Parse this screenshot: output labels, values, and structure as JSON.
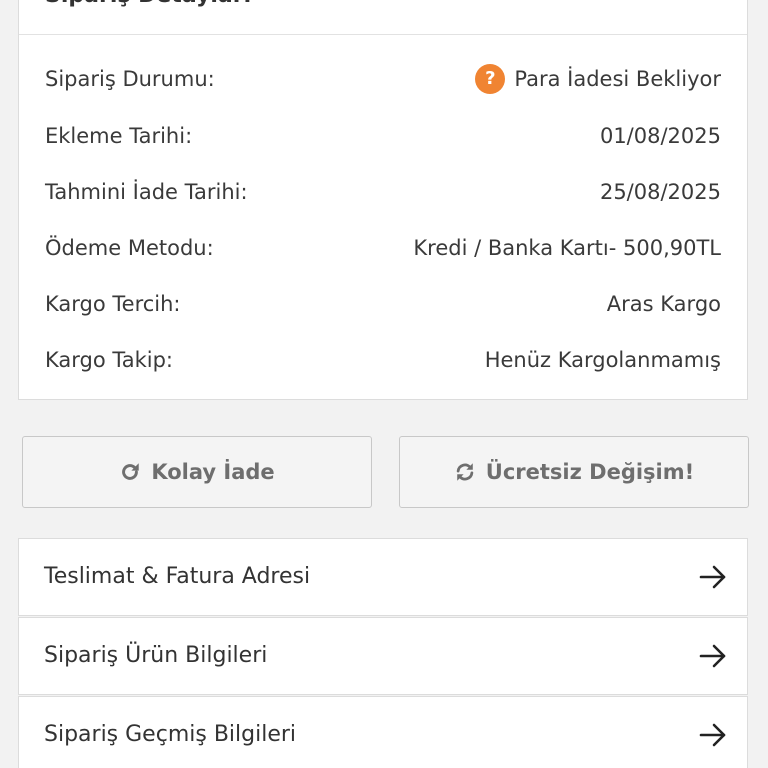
{
  "details": {
    "header_title": "Sipariş Detayları",
    "rows": [
      {
        "label": "Sipariş Durumu:",
        "value": "Para İadesi Bekliyor"
      },
      {
        "label": "Ekleme Tarihi:",
        "value": "01/08/2025"
      },
      {
        "label": "Tahmini İade Tarihi:",
        "value": "25/08/2025"
      },
      {
        "label": "Ödeme Metodu:",
        "value": "Kredi / Banka Kartı- 500,90TL"
      },
      {
        "label": "Kargo Tercih:",
        "value": "Aras Kargo"
      },
      {
        "label": "Kargo Takip:",
        "value": "Henüz Kargolanmamış"
      }
    ],
    "status_icon": "question-circle-icon",
    "status_icon_glyph": "?",
    "status_color": "#f08432"
  },
  "actions": {
    "easy_return_label": "Kolay İade",
    "easy_return_icon": "redo-icon",
    "free_exchange_label": "Ücretsiz Değişim!",
    "free_exchange_icon": "refresh-icon"
  },
  "nav": {
    "items": [
      {
        "label": "Teslimat & Fatura Adresi",
        "icon": "arrow-right-icon"
      },
      {
        "label": "Sipariş Ürün Bilgileri",
        "icon": "arrow-right-icon"
      },
      {
        "label": "Sipariş Geçmiş Bilgileri",
        "icon": "arrow-right-icon"
      }
    ]
  }
}
